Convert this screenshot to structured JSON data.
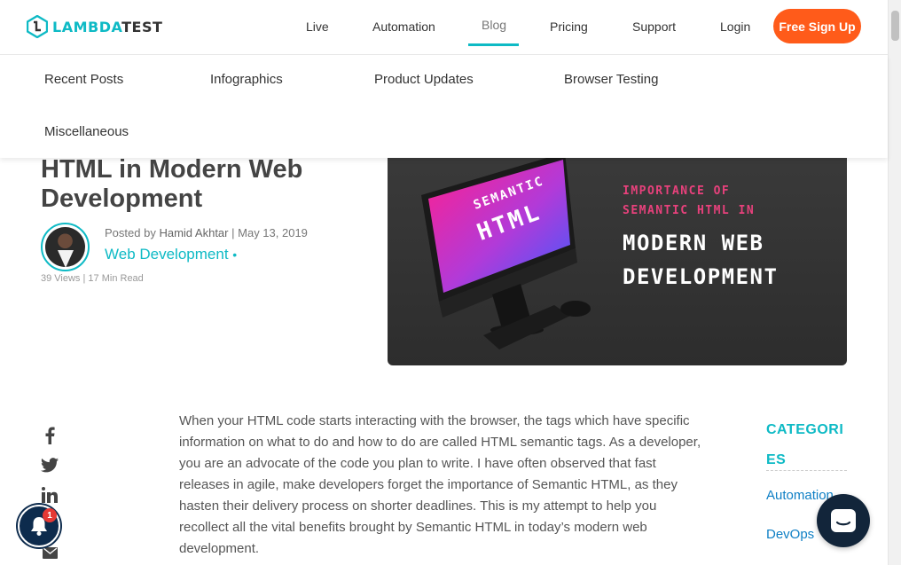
{
  "header": {
    "logo_text_accent": "LAMBDA",
    "logo_text_dark": "TEST",
    "nav": [
      {
        "label": "Live"
      },
      {
        "label": "Automation"
      },
      {
        "label": "Blog"
      },
      {
        "label": "Pricing"
      },
      {
        "label": "Support"
      },
      {
        "label": "Login"
      }
    ],
    "active_nav": "Blog",
    "signup_label": "Free Sign Up"
  },
  "subnav": {
    "items": [
      {
        "label": "Recent Posts"
      },
      {
        "label": "Infographics"
      },
      {
        "label": "Product Updates"
      },
      {
        "label": "Browser Testing"
      },
      {
        "label": "Miscellaneous"
      }
    ]
  },
  "article": {
    "title": "HTML in Modern Web Development",
    "byline_prefix": "Posted by",
    "author": "Hamid Akhtar",
    "separator": "|",
    "date": "May 13, 2019",
    "category": "Web Development",
    "category_dot": "•",
    "views": "39 Views",
    "read_time": "17 Min Read",
    "hero": {
      "screen_line1": "SEMANTIC",
      "screen_line2": "HTML",
      "pink_line1": "IMPORTANCE OF",
      "pink_line2": "SEMANTIC HTML IN",
      "white_line1": "MODERN WEB",
      "white_line2": "DEVELOPMENT"
    },
    "body": "When your HTML code starts interacting with the browser, the tags which have specific information on what to do and how to do are called HTML semantic tags. As a developer, you are an advocate of the code you plan to write. I have often observed that fast releases in agile, make developers forget the importance of Semantic HTML, as they hasten their delivery process on shorter deadlines. This is my attempt to help you recollect all the vital benefits brought by Semantic HTML in today’s modern web development."
  },
  "share": {
    "icons": [
      "facebook-icon",
      "twitter-icon",
      "linkedin-icon",
      "email-icon"
    ]
  },
  "sidebar": {
    "categories_title": "CATEGORIES",
    "items": [
      {
        "label": "Automation"
      },
      {
        "label": "DevOps"
      }
    ]
  },
  "notification": {
    "badge": "1"
  },
  "colors": {
    "brand": "#0ebac5",
    "signup": "#ff5b1a",
    "bell_bg": "#0d2b4d",
    "chat_bg": "#12253a"
  }
}
